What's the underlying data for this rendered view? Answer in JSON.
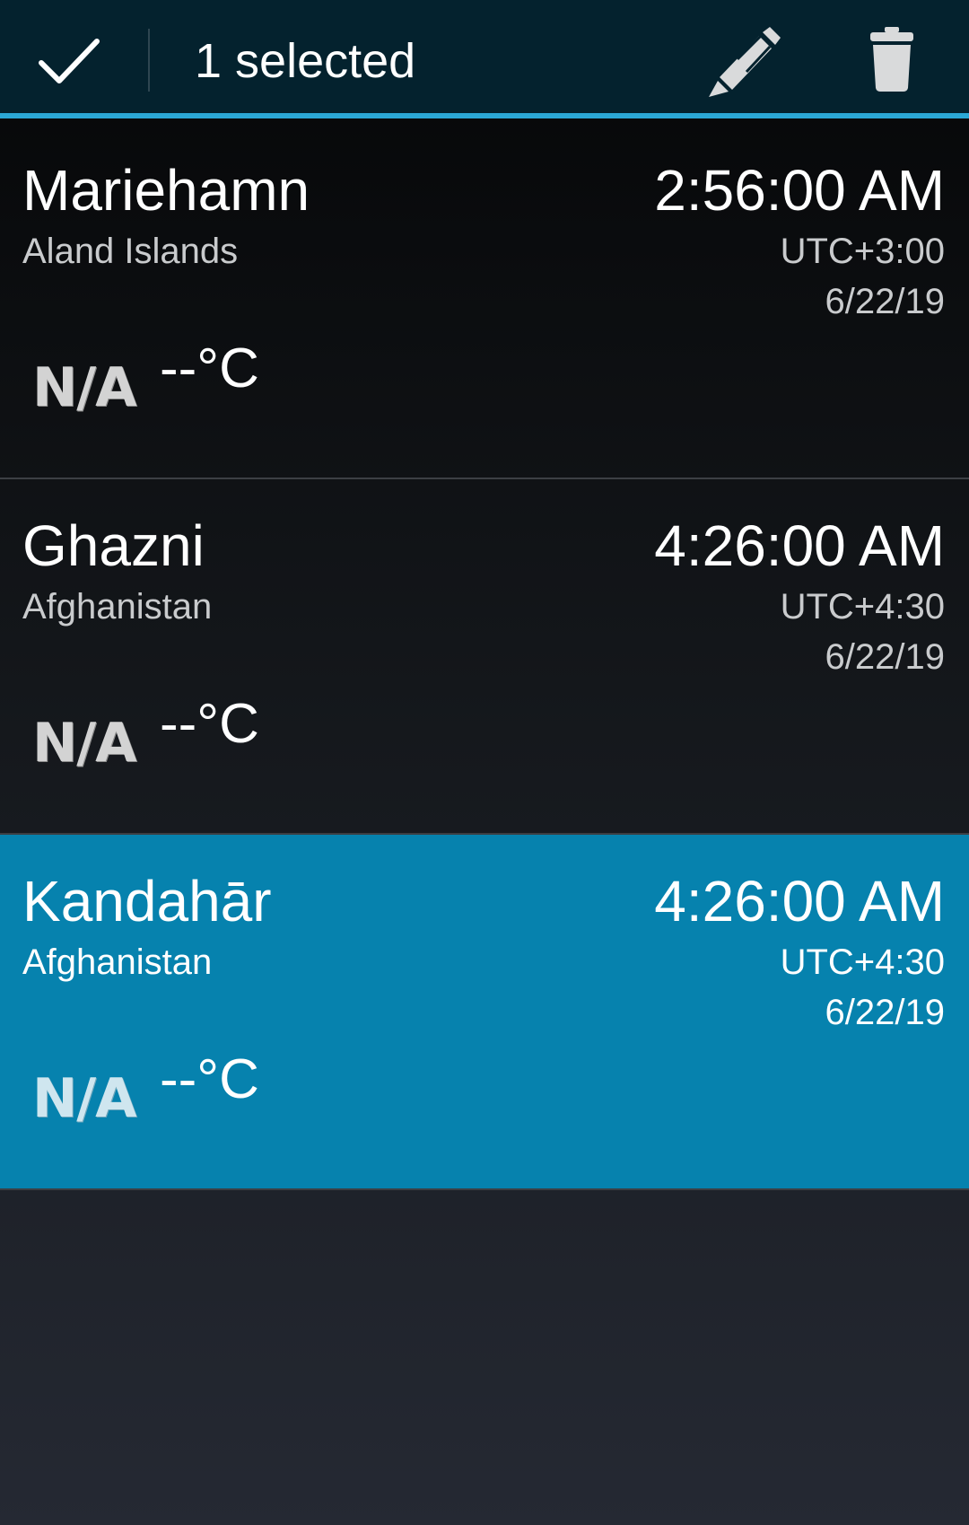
{
  "action_bar": {
    "selected_label": "1 selected",
    "done_icon": "checkmark-icon",
    "edit_icon": "pencil-icon",
    "delete_icon": "trash-icon",
    "background_color": "#04222e",
    "accent_color": "#2ba8d6"
  },
  "cities": [
    {
      "name": "Mariehamn",
      "country": "Aland Islands",
      "time": "2:56:00 AM",
      "utc_offset": "UTC+3:00",
      "date": "6/22/19",
      "weather": "N/A",
      "temperature": "--°C",
      "selected": false
    },
    {
      "name": "Ghazni",
      "country": "Afghanistan",
      "time": "4:26:00 AM",
      "utc_offset": "UTC+4:30",
      "date": "6/22/19",
      "weather": "N/A",
      "temperature": "--°C",
      "selected": false
    },
    {
      "name": "Kandahār",
      "country": "Afghanistan",
      "time": "4:26:00 AM",
      "utc_offset": "UTC+4:30",
      "date": "6/22/19",
      "weather": "N/A",
      "temperature": "--°C",
      "selected": true
    }
  ],
  "selection_color": "#0682ae"
}
